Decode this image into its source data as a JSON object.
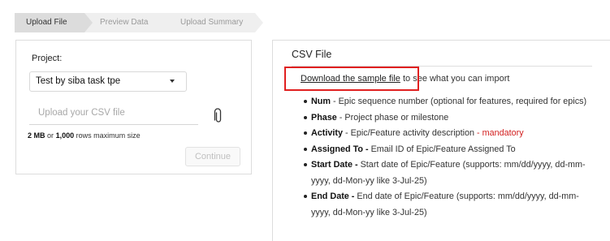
{
  "stepper": {
    "steps": [
      "Upload File",
      "Preview Data",
      "Upload Summary"
    ]
  },
  "upload_form": {
    "project_label": "Project:",
    "project_value": "Test by siba task tpe",
    "upload_placeholder": "Upload your CSV file",
    "size_limit": {
      "size": "2 MB",
      "or": "or",
      "rows": "1,000",
      "suffix": "rows maximum size"
    },
    "continue_label": "Continue"
  },
  "csv_info": {
    "title": "CSV File",
    "sample_link": "Download the sample file",
    "sample_suffix": "to see what you can import",
    "fields": [
      {
        "name": "Num",
        "sep": " - ",
        "desc": "Epic sequence number (optional for features, required for epics)",
        "mandatory": ""
      },
      {
        "name": "Phase",
        "sep": " - ",
        "desc": "Project phase or milestone",
        "mandatory": ""
      },
      {
        "name": "Activity",
        "sep": " - ",
        "desc": "Epic/Feature activity description",
        "mandatory": " - mandatory"
      },
      {
        "name": "Assigned To -",
        "sep": " ",
        "desc": "Email ID of Epic/Feature Assigned To",
        "mandatory": ""
      },
      {
        "name": "Start Date -",
        "sep": " ",
        "desc": "Start date of Epic/Feature (supports: mm/dd/yyyy, dd-mm-yyyy, dd-Mon-yy like 3-Jul-25)",
        "mandatory": ""
      },
      {
        "name": "End Date -",
        "sep": " ",
        "desc": "End date of Epic/Feature (supports: mm/dd/yyyy, dd-mm-yyyy, dd-Mon-yy like 3-Jul-25)",
        "mandatory": ""
      }
    ]
  },
  "colors": {
    "highlight": "#e02020",
    "mandatory": "#d21f1f",
    "active_step": "#dcdcdc"
  },
  "icons": {
    "upload": "paperclip-icon",
    "dropdown": "chevron-down-icon"
  }
}
